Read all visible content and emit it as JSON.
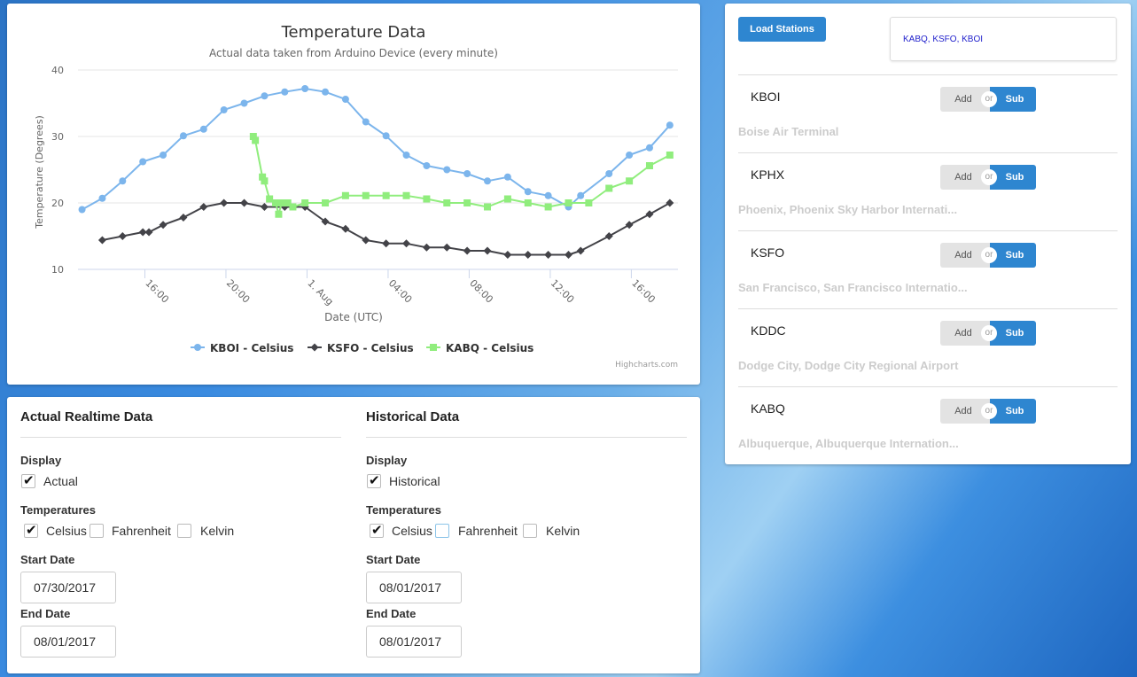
{
  "chart_data": {
    "type": "line",
    "title": "Temperature Data",
    "subtitle": "Actual data taken from Arduino Device (every minute)",
    "xlabel": "Date (UTC)",
    "ylabel": "Temperature (Degrees)",
    "ylim": [
      10,
      40
    ],
    "yticks": [
      "10",
      "20",
      "30",
      "40"
    ],
    "xticks": [
      {
        "hour": 16,
        "label": "16:00"
      },
      {
        "hour": 20,
        "label": "20:00"
      },
      {
        "hour": 24,
        "label": "1. Aug"
      },
      {
        "hour": 28,
        "label": "04:00"
      },
      {
        "hour": 32,
        "label": "08:00"
      },
      {
        "hour": 36,
        "label": "12:00"
      },
      {
        "hour": 40,
        "label": "16:00"
      }
    ],
    "xlim_hours": [
      12.7,
      42.3
    ],
    "credits": "Highcharts.com",
    "legend_position": "bottom",
    "grid": true,
    "series": [
      {
        "name": "KBOI - Celsius",
        "color": "#7cb5ec",
        "marker": "circle",
        "points": [
          [
            12.9,
            19
          ],
          [
            13.9,
            20.7
          ],
          [
            14.9,
            23.3
          ],
          [
            15.9,
            26.2
          ],
          [
            16.9,
            27.2
          ],
          [
            17.9,
            30.1
          ],
          [
            18.9,
            31.1
          ],
          [
            19.9,
            34
          ],
          [
            20.9,
            35
          ],
          [
            21.9,
            36.1
          ],
          [
            22.9,
            36.7
          ],
          [
            23.9,
            37.2
          ],
          [
            24.9,
            36.7
          ],
          [
            25.9,
            35.6
          ],
          [
            26.9,
            32.2
          ],
          [
            27.9,
            30.1
          ],
          [
            28.9,
            27.2
          ],
          [
            29.9,
            25.6
          ],
          [
            30.9,
            25
          ],
          [
            31.9,
            24.4
          ],
          [
            32.9,
            23.3
          ],
          [
            33.9,
            23.9
          ],
          [
            34.9,
            21.7
          ],
          [
            35.9,
            21.1
          ],
          [
            36.9,
            19.4
          ],
          [
            37.5,
            21.1
          ],
          [
            38.9,
            24.4
          ],
          [
            39.9,
            27.2
          ],
          [
            40.9,
            28.3
          ],
          [
            41.9,
            31.7
          ]
        ]
      },
      {
        "name": "KSFO - Celsius",
        "color": "#434348",
        "marker": "diamond",
        "points": [
          [
            13.9,
            14.4
          ],
          [
            14.9,
            15
          ],
          [
            15.9,
            15.6
          ],
          [
            16.2,
            15.6
          ],
          [
            16.9,
            16.7
          ],
          [
            17.9,
            17.8
          ],
          [
            18.9,
            19.4
          ],
          [
            19.9,
            20
          ],
          [
            20.9,
            20
          ],
          [
            21.9,
            19.4
          ],
          [
            22.9,
            19.4
          ],
          [
            23.9,
            19.4
          ],
          [
            24.9,
            17.2
          ],
          [
            25.9,
            16.1
          ],
          [
            26.9,
            14.4
          ],
          [
            27.9,
            13.9
          ],
          [
            28.9,
            13.9
          ],
          [
            29.9,
            13.3
          ],
          [
            30.9,
            13.3
          ],
          [
            31.9,
            12.8
          ],
          [
            32.9,
            12.8
          ],
          [
            33.9,
            12.2
          ],
          [
            34.9,
            12.2
          ],
          [
            35.9,
            12.2
          ],
          [
            36.9,
            12.2
          ],
          [
            37.5,
            12.8
          ],
          [
            38.9,
            15
          ],
          [
            39.9,
            16.7
          ],
          [
            40.9,
            18.3
          ],
          [
            41.9,
            20
          ]
        ]
      },
      {
        "name": "KABQ - Celsius",
        "color": "#90ed7d",
        "marker": "square",
        "points": [
          [
            21.35,
            30
          ],
          [
            21.45,
            29.4
          ],
          [
            21.8,
            23.9
          ],
          [
            21.9,
            23.3
          ],
          [
            22.15,
            20.6
          ],
          [
            22.45,
            20
          ],
          [
            22.6,
            18.3
          ],
          [
            22.75,
            20
          ],
          [
            23.05,
            20
          ],
          [
            23.3,
            19.4
          ],
          [
            23.9,
            20
          ],
          [
            24.9,
            20
          ],
          [
            25.9,
            21.1
          ],
          [
            26.9,
            21.1
          ],
          [
            27.9,
            21.1
          ],
          [
            28.9,
            21.1
          ],
          [
            29.9,
            20.6
          ],
          [
            30.9,
            20
          ],
          [
            31.9,
            20
          ],
          [
            32.9,
            19.4
          ],
          [
            33.9,
            20.6
          ],
          [
            34.9,
            20
          ],
          [
            35.9,
            19.4
          ],
          [
            36.9,
            20
          ],
          [
            37.9,
            20
          ],
          [
            38.9,
            22.2
          ],
          [
            39.9,
            23.3
          ],
          [
            40.9,
            25.6
          ],
          [
            41.9,
            27.2
          ]
        ]
      }
    ]
  },
  "realtime": {
    "title": "Actual Realtime Data",
    "display_label": "Display",
    "display_option": "Actual",
    "display_checked": true,
    "temps_label": "Temperatures",
    "temps": [
      {
        "label": "Celsius",
        "checked": true
      },
      {
        "label": "Fahrenheit",
        "checked": false
      },
      {
        "label": "Kelvin",
        "checked": false
      }
    ],
    "start_label": "Start Date",
    "start_value": "07/30/2017",
    "end_label": "End Date",
    "end_value": "08/01/2017"
  },
  "historical": {
    "title": "Historical Data",
    "display_label": "Display",
    "display_option": "Historical",
    "display_checked": true,
    "temps_label": "Temperatures",
    "temps": [
      {
        "label": "Celsius",
        "checked": true
      },
      {
        "label": "Fahrenheit",
        "checked": false
      },
      {
        "label": "Kelvin",
        "checked": false
      }
    ],
    "start_label": "Start Date",
    "start_value": "08/01/2017",
    "end_label": "End Date",
    "end_value": "08/01/2017"
  },
  "stations": {
    "load_label": "Load Stations",
    "selected": "KABQ, KSFO, KBOI",
    "toggle_add": "Add",
    "toggle_or": "or",
    "toggle_sub": "Sub",
    "list": [
      {
        "code": "KBOI",
        "name": "Boise Air Terminal"
      },
      {
        "code": "KPHX",
        "name": "Phoenix, Phoenix Sky Harbor Internati..."
      },
      {
        "code": "KSFO",
        "name": "San Francisco, San Francisco Internatio..."
      },
      {
        "code": "KDDC",
        "name": "Dodge City, Dodge City Regional Airport"
      },
      {
        "code": "KABQ",
        "name": "Albuquerque, Albuquerque Internation..."
      }
    ]
  }
}
